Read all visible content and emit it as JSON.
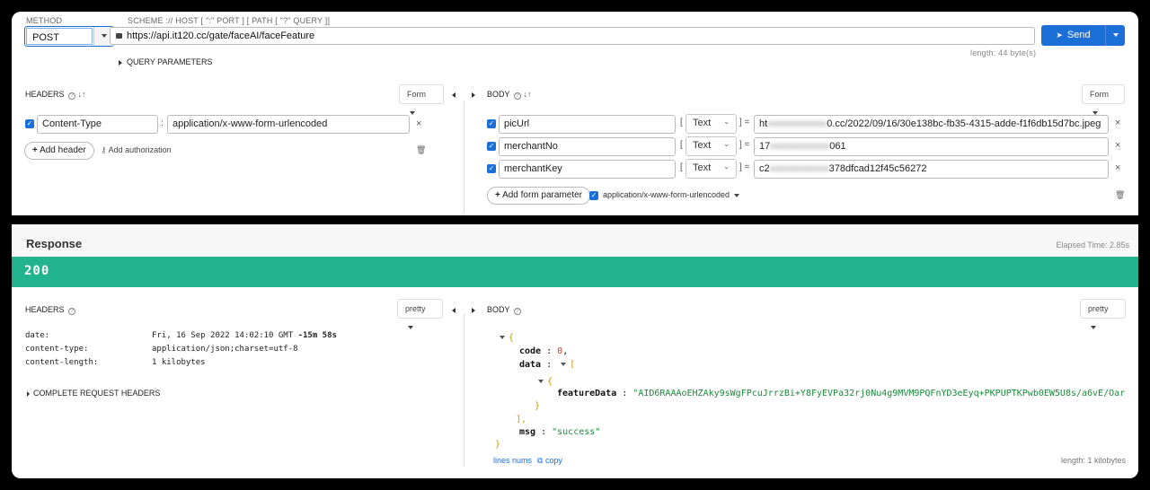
{
  "request": {
    "method_label": "METHOD",
    "method": "POST",
    "url_label": "SCHEME :// HOST [ \":\" PORT ] [ PATH [ \"?\" QUERY ]]",
    "url": "https://api.it120.cc/gate/faceAI/faceFeature",
    "length": "length: 44 byte(s)",
    "send_label": "Send",
    "query_params_label": "QUERY PARAMETERS",
    "headers": {
      "title": "HEADERS",
      "form_label": "Form",
      "rows": [
        {
          "key": "Content-Type",
          "value": "application/x-www-form-urlencoded"
        }
      ],
      "add_header": "Add header",
      "add_auth": "Add authorization"
    },
    "body": {
      "title": "BODY",
      "form_label": "Form",
      "rows": [
        {
          "key": "picUrl",
          "type": "Text",
          "value_pre": "ht",
          "value_post": "0.cc/2022/09/16/30e138bc-fb35-4315-adde-f1f6db15d7bc.jpeg"
        },
        {
          "key": "merchantNo",
          "type": "Text",
          "value_pre": "17",
          "value_post": "061"
        },
        {
          "key": "merchantKey",
          "type": "Text",
          "value_pre": "c2",
          "value_post": "378dfcad12f45c56272"
        }
      ],
      "add_param": "Add form parameter",
      "encoding": "application/x-www-form-urlencoded"
    }
  },
  "response": {
    "title": "Response",
    "elapsed": "Elapsed Time: 2.85s",
    "status": "200",
    "status_color": "#22b38f",
    "headers": {
      "title": "HEADERS",
      "pretty": "pretty",
      "rows": [
        {
          "key": "date:",
          "value": "Fri, 16 Sep 2022 14:02:10 GMT",
          "extra": "-15m 58s"
        },
        {
          "key": "content-type:",
          "value": "application/json;charset=utf-8",
          "extra": ""
        },
        {
          "key": "content-length:",
          "value": "1 kilobytes",
          "extra": ""
        }
      ],
      "complete": "COMPLETE REQUEST HEADERS"
    },
    "body": {
      "title": "BODY",
      "pretty": "pretty",
      "code_key": "code",
      "code_val": "0",
      "data_key": "data",
      "feature_key": "featureData",
      "feature_val": "\"AID6RAAAoEHZAky9sWgFPcuJrrzBi+Y8FyEVPa32rj0Nu4g9MVM9PQFnYD3eEyq+PKPUPTKPwb0EW5U8s/a6vE/Oar",
      "msg_key": "msg",
      "msg_val": "\"success\"",
      "lines_nums": "lines nums",
      "copy": "copy",
      "length": "length: 1 kilobytes"
    }
  }
}
